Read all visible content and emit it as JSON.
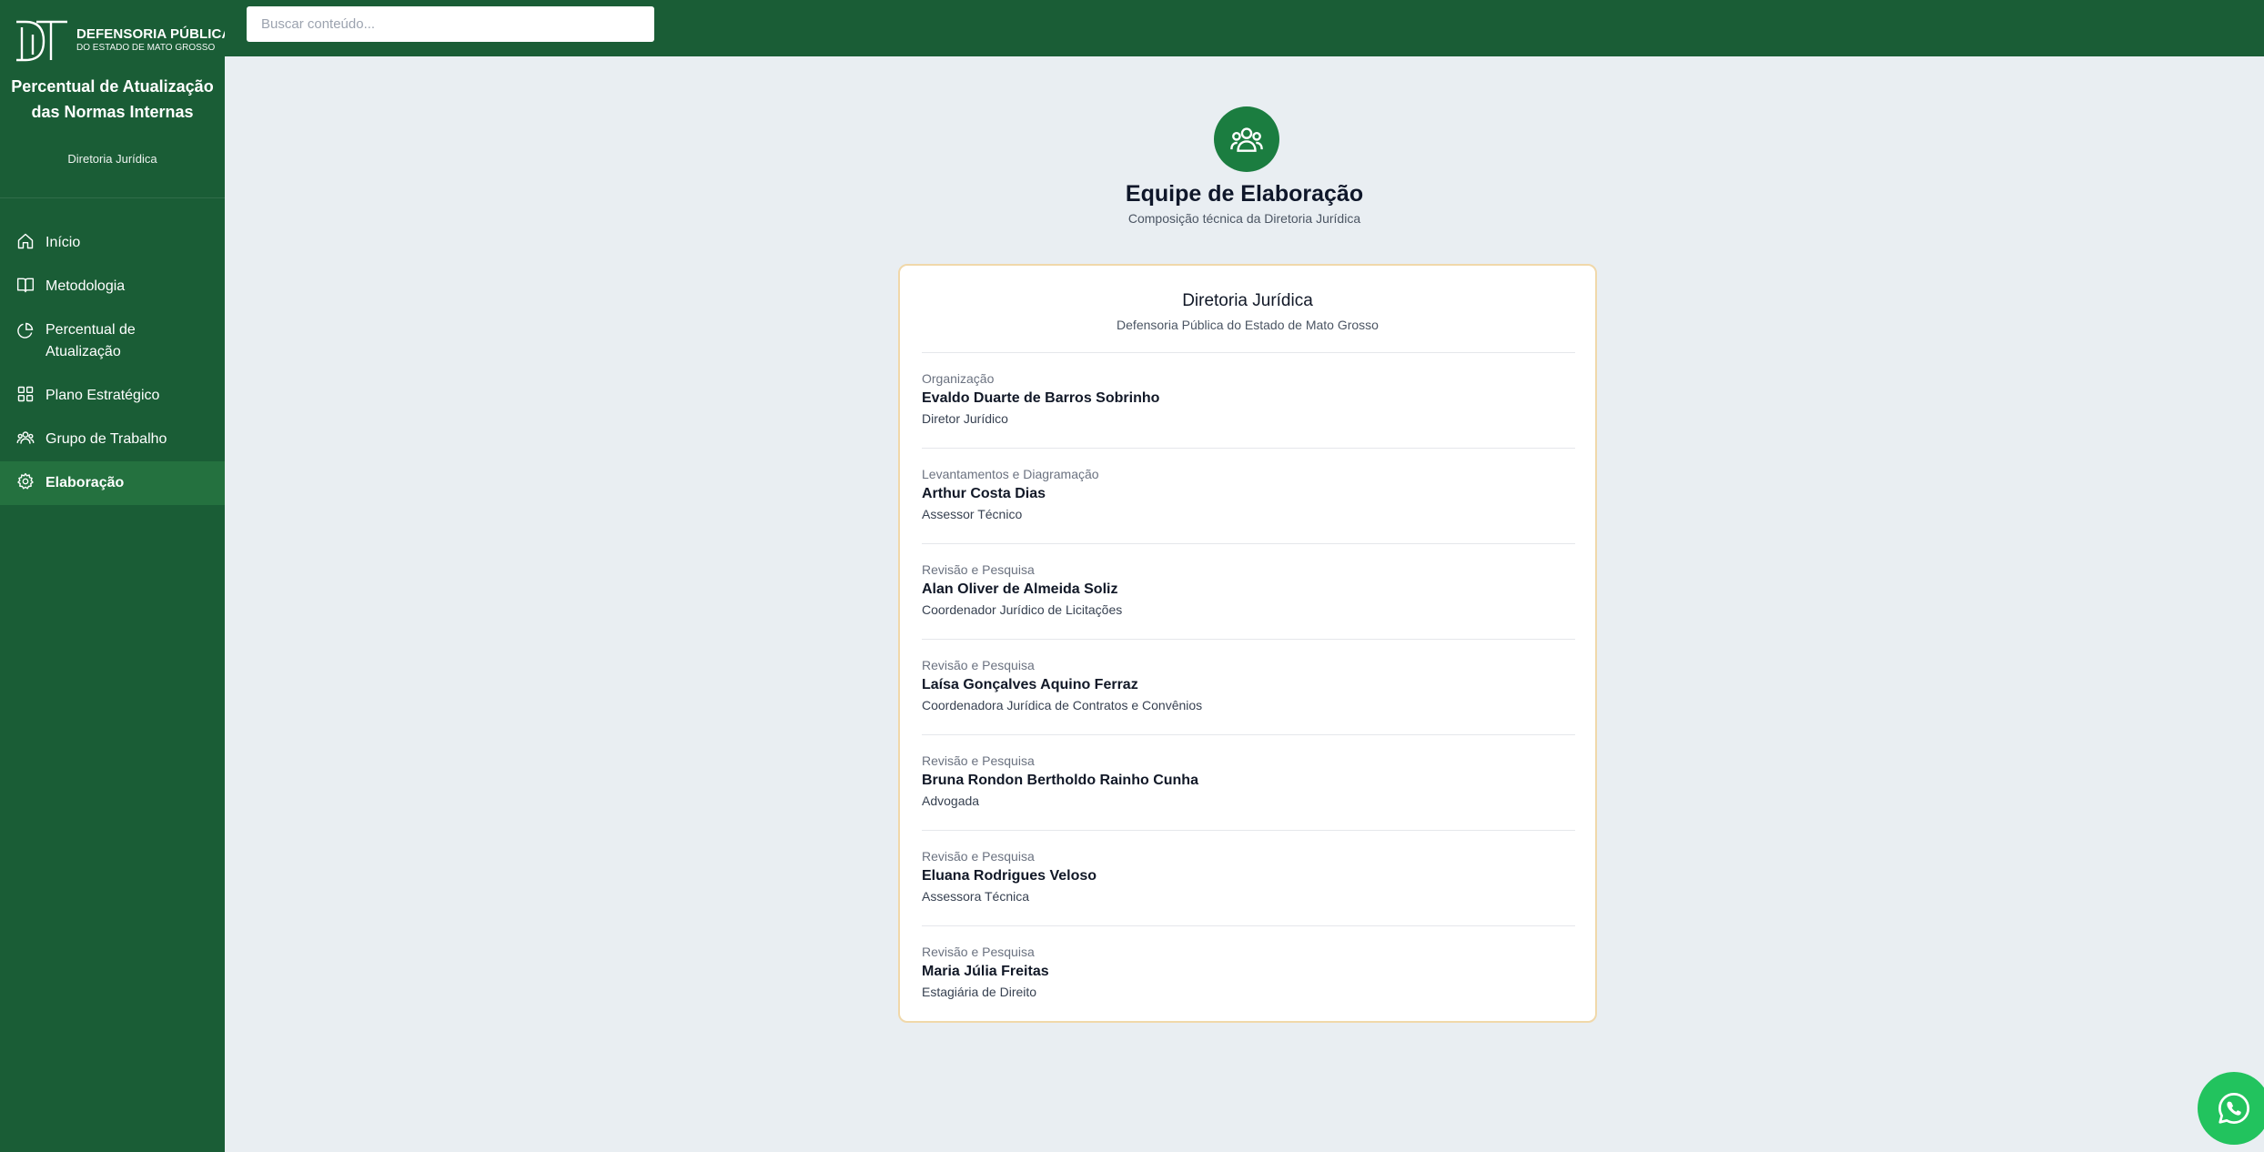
{
  "logo": {
    "title": "DEFENSORIA PÚBLICA",
    "subtitle": "DO ESTADO DE MATO GROSSO"
  },
  "app": {
    "title": "Percentual de Atualização das Normas Internas",
    "subtitle": "Diretoria Jurídica"
  },
  "nav": [
    {
      "label": "Início",
      "icon": "home-icon"
    },
    {
      "label": "Metodologia",
      "icon": "book-icon"
    },
    {
      "label": "Percentual de Atualização",
      "icon": "pie-chart-icon"
    },
    {
      "label": "Plano Estratégico",
      "icon": "grid-icon"
    },
    {
      "label": "Grupo de Trabalho",
      "icon": "users-icon"
    },
    {
      "label": "Elaboração",
      "icon": "gear-icon",
      "active": true
    }
  ],
  "search": {
    "placeholder": "Buscar conteúdo..."
  },
  "page": {
    "title": "Equipe de Elaboração",
    "subtitle": "Composição técnica da Diretoria Jurídica"
  },
  "card": {
    "title": "Diretoria Jurídica",
    "subtitle": "Defensoria Pública do Estado de Mato Grosso",
    "members": [
      {
        "role": "Organização",
        "name": "Evaldo Duarte de Barros Sobrinho",
        "position": "Diretor Jurídico"
      },
      {
        "role": "Levantamentos e Diagramação",
        "name": "Arthur Costa Dias",
        "position": "Assessor Técnico"
      },
      {
        "role": "Revisão e Pesquisa",
        "name": "Alan Oliver de Almeida Soliz",
        "position": "Coordenador Jurídico de Licitações"
      },
      {
        "role": "Revisão e Pesquisa",
        "name": "Laísa Gonçalves Aquino Ferraz",
        "position": "Coordenadora Jurídica de Contratos e Convênios"
      },
      {
        "role": "Revisão e Pesquisa",
        "name": "Bruna Rondon Bertholdo Rainho Cunha",
        "position": "Advogada"
      },
      {
        "role": "Revisão e Pesquisa",
        "name": "Eluana Rodrigues Veloso",
        "position": "Assessora Técnica"
      },
      {
        "role": "Revisão e Pesquisa",
        "name": "Maria Júlia Freitas",
        "position": "Estagiária de Direito"
      }
    ]
  },
  "colors": {
    "brand": "#1a5d36",
    "active": "#24713f",
    "accent": "#1b7d40",
    "card_border": "#f0d8aa",
    "whatsapp": "#22c35e"
  }
}
